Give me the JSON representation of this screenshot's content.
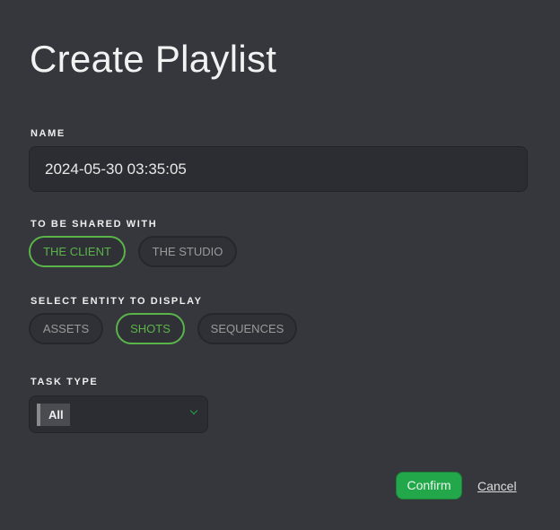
{
  "title": "Create Playlist",
  "name": {
    "label": "NAME",
    "value": "2024-05-30 03:35:05"
  },
  "shared": {
    "label": "TO BE SHARED WITH",
    "options": [
      "THE CLIENT",
      "THE STUDIO"
    ],
    "selected": "THE CLIENT"
  },
  "entity": {
    "label": "SELECT ENTITY TO DISPLAY",
    "options": [
      "ASSETS",
      "SHOTS",
      "SEQUENCES"
    ],
    "selected": "SHOTS"
  },
  "task_type": {
    "label": "TASK TYPE",
    "value": "All"
  },
  "actions": {
    "confirm": "Confirm",
    "cancel": "Cancel"
  },
  "colors": {
    "accent": "#5ab44a",
    "confirm": "#22a84a",
    "background": "#36373d"
  }
}
